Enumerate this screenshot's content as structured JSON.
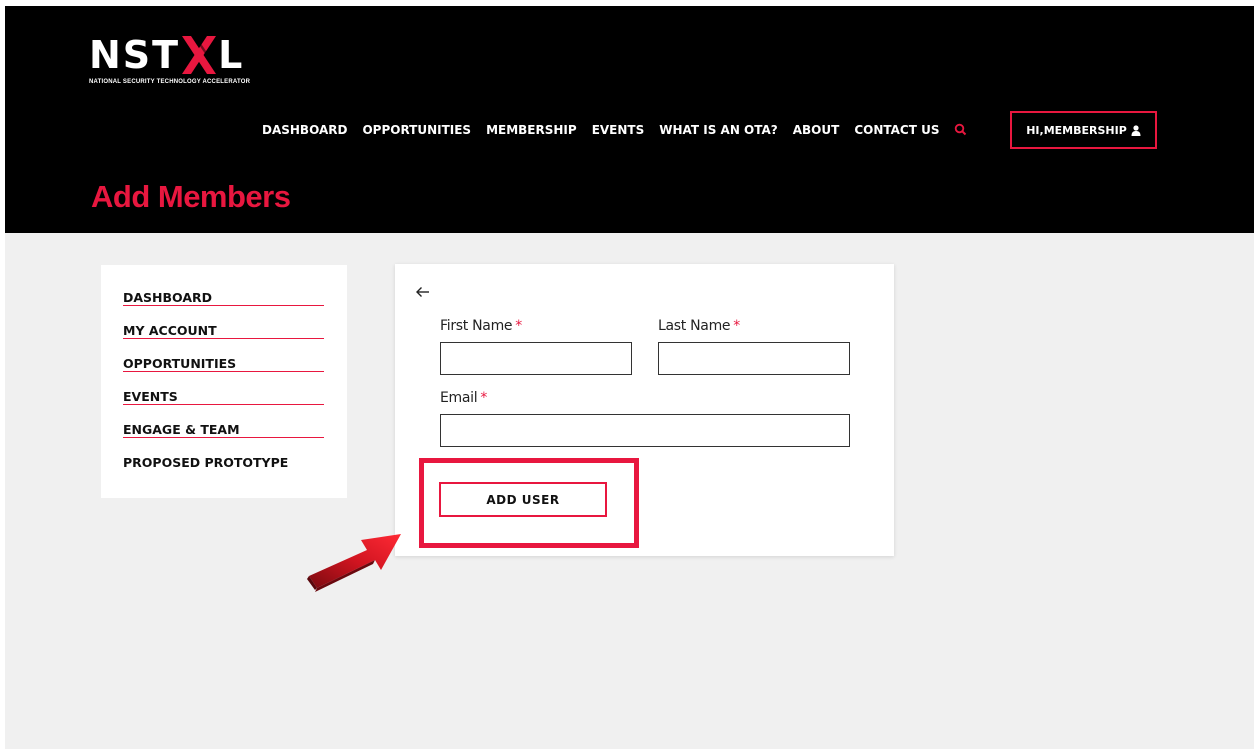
{
  "logo": {
    "wordmark_left": "NST",
    "wordmark_right": "L",
    "tagline": "NATIONAL SECURITY TECHNOLOGY ACCELERATOR"
  },
  "nav": {
    "items": [
      {
        "label": "DASHBOARD"
      },
      {
        "label": "OPPORTUNITIES"
      },
      {
        "label": "MEMBERSHIP"
      },
      {
        "label": "EVENTS"
      },
      {
        "label": "WHAT IS AN OTA?"
      },
      {
        "label": "ABOUT"
      },
      {
        "label": "CONTACT US"
      }
    ],
    "search_icon": "search-icon",
    "user_button": "HI,MEMBERSHIP",
    "user_icon": "user-icon"
  },
  "page": {
    "title": "Add Members"
  },
  "sidebar": {
    "items": [
      {
        "label": "DASHBOARD"
      },
      {
        "label": "MY ACCOUNT"
      },
      {
        "label": "OPPORTUNITIES"
      },
      {
        "label": "EVENTS"
      },
      {
        "label": "ENGAGE & TEAM"
      },
      {
        "label": "PROPOSED PROTOTYPE"
      }
    ]
  },
  "form": {
    "back_icon": "arrow-left-icon",
    "first_name_label": "First Name",
    "last_name_label": "Last Name",
    "email_label": "Email",
    "required_mark": "*",
    "first_name_value": "",
    "last_name_value": "",
    "email_value": "",
    "submit_label": "ADD USER"
  },
  "colors": {
    "accent": "#e8173f",
    "header_bg": "#000000",
    "page_bg": "#f0f0f0",
    "annotation_arrow": "#c0101a"
  }
}
